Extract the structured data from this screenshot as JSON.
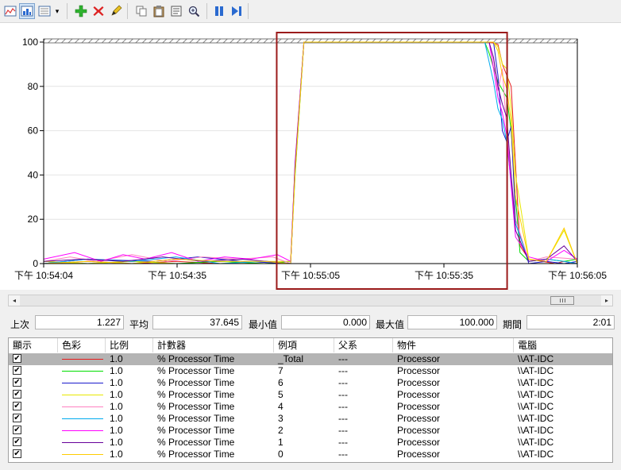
{
  "toolbar": {
    "buttons": [
      {
        "name": "view-graph-icon",
        "glyph": "📈"
      },
      {
        "name": "view-histogram-icon",
        "glyph": "▮"
      },
      {
        "name": "view-report-icon",
        "glyph": "▤"
      },
      {
        "name": "dropdown-arrow-icon",
        "glyph": "▾"
      },
      {
        "name": "add-counter-icon",
        "glyph": "+"
      },
      {
        "name": "delete-counter-icon",
        "glyph": "✖"
      },
      {
        "name": "highlight-icon",
        "glyph": "✎"
      },
      {
        "name": "copy-properties-icon",
        "glyph": "⎘"
      },
      {
        "name": "paste-counter-list-icon",
        "glyph": "📋"
      },
      {
        "name": "properties-icon",
        "glyph": "▣"
      },
      {
        "name": "zoom-icon",
        "glyph": "🔍"
      },
      {
        "name": "freeze-display-icon",
        "glyph": "❚❚"
      },
      {
        "name": "update-data-icon",
        "glyph": "▶|"
      }
    ]
  },
  "chart_data": {
    "type": "line",
    "title": "",
    "xlabel": "",
    "ylabel": "",
    "ylim": [
      0,
      100
    ],
    "y_ticks": [
      "0",
      "20",
      "40",
      "60",
      "80",
      "100"
    ],
    "x_tick_labels": [
      "下午 10:54:04",
      "下午 10:54:35",
      "下午 10:55:05",
      "下午 10:55:35",
      "下午 10:56:05"
    ],
    "x_range_seconds": [
      0,
      121
    ],
    "zoom_selection_seconds": [
      55,
      104
    ],
    "grid": true,
    "series": [
      {
        "color": "#e81c1c",
        "x": [
          0,
          10,
          20,
          30,
          40,
          50,
          56,
          57,
          59,
          60,
          90,
          101,
          103,
          104,
          106,
          108,
          110,
          113,
          116,
          118,
          121
        ],
        "y": [
          0,
          1,
          0,
          1,
          0,
          0,
          0,
          45,
          100,
          100,
          100,
          100,
          99,
          90,
          80,
          8,
          2,
          1,
          0,
          1,
          0
        ]
      },
      {
        "color": "#00dd00",
        "x": [
          0,
          10,
          20,
          30,
          40,
          50,
          56,
          57,
          59,
          60,
          90,
          100,
          101,
          103,
          105,
          106,
          107,
          108,
          110,
          114,
          118,
          121
        ],
        "y": [
          1,
          0,
          1,
          0,
          1,
          0,
          1,
          40,
          100,
          100,
          100,
          100,
          95,
          82,
          75,
          60,
          30,
          5,
          1,
          2,
          1,
          2
        ]
      },
      {
        "color": "#1a1acc",
        "x": [
          0,
          5,
          10,
          25,
          35,
          45,
          56,
          57,
          59,
          60,
          90,
          102,
          103,
          104,
          105,
          106,
          107,
          110,
          114,
          118,
          121
        ],
        "y": [
          0,
          1,
          2,
          1,
          3,
          1,
          0,
          44,
          100,
          100,
          100,
          100,
          85,
          60,
          55,
          62,
          20,
          0,
          1,
          0,
          1
        ]
      },
      {
        "color": "#e8e800",
        "x": [
          0,
          10,
          20,
          30,
          40,
          50,
          56,
          57,
          59,
          60,
          90,
          102,
          103,
          104,
          105,
          106,
          107,
          110,
          114,
          118,
          121
        ],
        "y": [
          1,
          0,
          1,
          0,
          0,
          1,
          1,
          42,
          100,
          100,
          100,
          100,
          98,
          90,
          88,
          70,
          40,
          2,
          1,
          15,
          0
        ]
      },
      {
        "color": "#ff80c0",
        "x": [
          0,
          6,
          12,
          20,
          28,
          36,
          44,
          52,
          56,
          57,
          59,
          60,
          90,
          101,
          102,
          103,
          104,
          105,
          107,
          110,
          114,
          121
        ],
        "y": [
          1,
          3,
          1,
          4,
          1,
          3,
          2,
          3,
          0,
          46,
          100,
          100,
          100,
          100,
          92,
          78,
          88,
          60,
          20,
          1,
          3,
          2
        ]
      },
      {
        "color": "#00aaee",
        "x": [
          0,
          10,
          20,
          30,
          40,
          50,
          56,
          57,
          59,
          60,
          90,
          100,
          102,
          103,
          104,
          105,
          107,
          110,
          114,
          118,
          121
        ],
        "y": [
          0,
          2,
          1,
          3,
          0,
          1,
          0,
          43,
          100,
          100,
          100,
          100,
          82,
          70,
          65,
          55,
          18,
          1,
          2,
          1,
          0
        ]
      },
      {
        "color": "#ff00ff",
        "x": [
          0,
          7,
          13,
          18,
          23,
          29,
          35,
          41,
          47,
          53,
          56,
          57,
          59,
          60,
          90,
          101,
          102,
          103,
          104,
          105,
          107,
          110,
          114,
          118,
          121
        ],
        "y": [
          2,
          5,
          1,
          4,
          2,
          5,
          1,
          3,
          2,
          4,
          1,
          45,
          100,
          100,
          100,
          100,
          88,
          75,
          68,
          58,
          12,
          3,
          1,
          6,
          2
        ]
      },
      {
        "color": "#660099",
        "x": [
          0,
          9,
          18,
          27,
          36,
          45,
          56,
          57,
          59,
          60,
          90,
          101,
          102,
          103,
          104,
          105,
          106,
          107,
          110,
          114,
          118,
          121
        ],
        "y": [
          1,
          2,
          1,
          3,
          1,
          2,
          0,
          44,
          100,
          100,
          100,
          100,
          93,
          80,
          72,
          66,
          40,
          15,
          1,
          2,
          8,
          1
        ]
      },
      {
        "color": "#ffcc00",
        "x": [
          0,
          10,
          20,
          30,
          40,
          50,
          56,
          57,
          59,
          60,
          90,
          102,
          103,
          104,
          105,
          106,
          107,
          110,
          114,
          118,
          121
        ],
        "y": [
          0,
          1,
          0,
          2,
          1,
          1,
          0,
          41,
          100,
          100,
          100,
          100,
          96,
          85,
          79,
          64,
          30,
          2,
          1,
          16,
          0
        ]
      }
    ]
  },
  "scrollbar": {
    "left_arrow": "◂",
    "right_arrow": "▸"
  },
  "stats": {
    "last_label": "上次",
    "last_value": "1.227",
    "avg_label": "平均",
    "avg_value": "37.645",
    "min_label": "最小值",
    "min_value": "0.000",
    "max_label": "最大值",
    "max_value": "100.000",
    "duration_label": "期間",
    "duration_value": "2:01"
  },
  "table": {
    "headers": [
      "顯示",
      "色彩",
      "比例",
      "計數器",
      "例項",
      "父系",
      "物件",
      "電腦"
    ],
    "rows": [
      {
        "checked": "✔",
        "color": "#e81c1c",
        "scale": "1.0",
        "counter": "% Processor Time",
        "instance": "_Total",
        "parent": "---",
        "object": "Processor",
        "computer": "\\\\AT-IDC"
      },
      {
        "checked": "✔",
        "color": "#00dd00",
        "scale": "1.0",
        "counter": "% Processor Time",
        "instance": "7",
        "parent": "---",
        "object": "Processor",
        "computer": "\\\\AT-IDC"
      },
      {
        "checked": "✔",
        "color": "#1a1acc",
        "scale": "1.0",
        "counter": "% Processor Time",
        "instance": "6",
        "parent": "---",
        "object": "Processor",
        "computer": "\\\\AT-IDC"
      },
      {
        "checked": "✔",
        "color": "#e8e800",
        "scale": "1.0",
        "counter": "% Processor Time",
        "instance": "5",
        "parent": "---",
        "object": "Processor",
        "computer": "\\\\AT-IDC"
      },
      {
        "checked": "✔",
        "color": "#ff80c0",
        "scale": "1.0",
        "counter": "% Processor Time",
        "instance": "4",
        "parent": "---",
        "object": "Processor",
        "computer": "\\\\AT-IDC"
      },
      {
        "checked": "✔",
        "color": "#00aaee",
        "scale": "1.0",
        "counter": "% Processor Time",
        "instance": "3",
        "parent": "---",
        "object": "Processor",
        "computer": "\\\\AT-IDC"
      },
      {
        "checked": "✔",
        "color": "#ff00ff",
        "scale": "1.0",
        "counter": "% Processor Time",
        "instance": "2",
        "parent": "---",
        "object": "Processor",
        "computer": "\\\\AT-IDC"
      },
      {
        "checked": "✔",
        "color": "#660099",
        "scale": "1.0",
        "counter": "% Processor Time",
        "instance": "1",
        "parent": "---",
        "object": "Processor",
        "computer": "\\\\AT-IDC"
      },
      {
        "checked": "✔",
        "color": "#ffcc00",
        "scale": "1.0",
        "counter": "% Processor Time",
        "instance": "0",
        "parent": "---",
        "object": "Processor",
        "computer": "\\\\AT-IDC"
      }
    ]
  }
}
